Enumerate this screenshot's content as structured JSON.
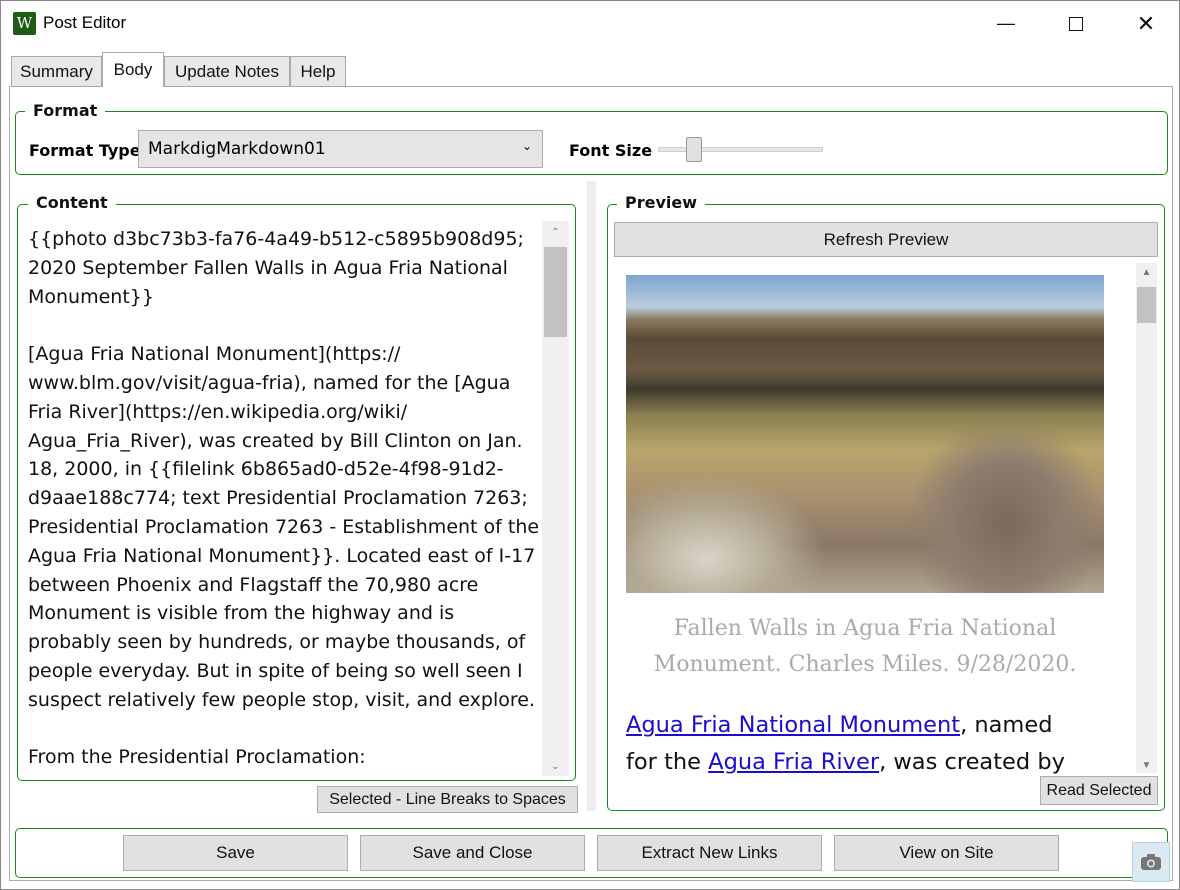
{
  "window": {
    "title": "Post Editor",
    "icon": "W"
  },
  "tabs": [
    {
      "label": "Summary"
    },
    {
      "label": "Body"
    },
    {
      "label": "Update Notes"
    },
    {
      "label": "Help"
    }
  ],
  "format": {
    "legend": "Format",
    "format_type_label": "Format Type",
    "format_type_value": "MarkdigMarkdown01",
    "font_size_label": "Font Size",
    "font_size_level": 0.19
  },
  "content": {
    "legend": "Content",
    "lines": [
      "{{photo d3bc73b3-fa76-4a49-b512-c5895b908d95;",
      "2020 September Fallen Walls in Agua Fria National",
      "Monument}}",
      "",
      "[Agua Fria National Monument](https://",
      "www.blm.gov/visit/agua-fria), named for the [Agua",
      "Fria River](https://en.wikipedia.org/wiki/",
      "Agua_Fria_River), was created by Bill Clinton on Jan.",
      "18, 2000, in {{filelink 6b865ad0-d52e-4f98-91d2-",
      "d9aae188c774; text Presidential Proclamation 7263;",
      "Presidential Proclamation 7263 - Establishment of the",
      "Agua Fria National Monument}}. Located east of I-17",
      "between Phoenix and Flagstaff the 70,980 acre",
      "Monument is visible from the highway and is",
      "probably seen by hundreds, or maybe thousands, of",
      "people everyday. But in spite of being so well seen I",
      "suspect relatively few people stop, visit, and explore.",
      "",
      "From the Presidential Proclamation:"
    ],
    "line_breaks_button": "Selected - Line Breaks to Spaces"
  },
  "preview": {
    "legend": "Preview",
    "refresh_button": "Refresh Preview",
    "caption": "Fallen Walls in Agua Fria National Monument. Charles Miles. 9/28/2020.",
    "link1": "Agua Fria National Monument",
    "text1": ", named",
    "text2": "for the ",
    "link2": "Agua Fria River",
    "text3": ", was created by",
    "read_selected_button": "Read Selected"
  },
  "footer": {
    "save": "Save",
    "save_close": "Save and Close",
    "extract_links": "Extract New Links",
    "view_site": "View on Site"
  },
  "colors": {
    "group_border": "#1a8a1a",
    "link": "#1a0dcc",
    "accent_icon": "#1e5c14"
  }
}
